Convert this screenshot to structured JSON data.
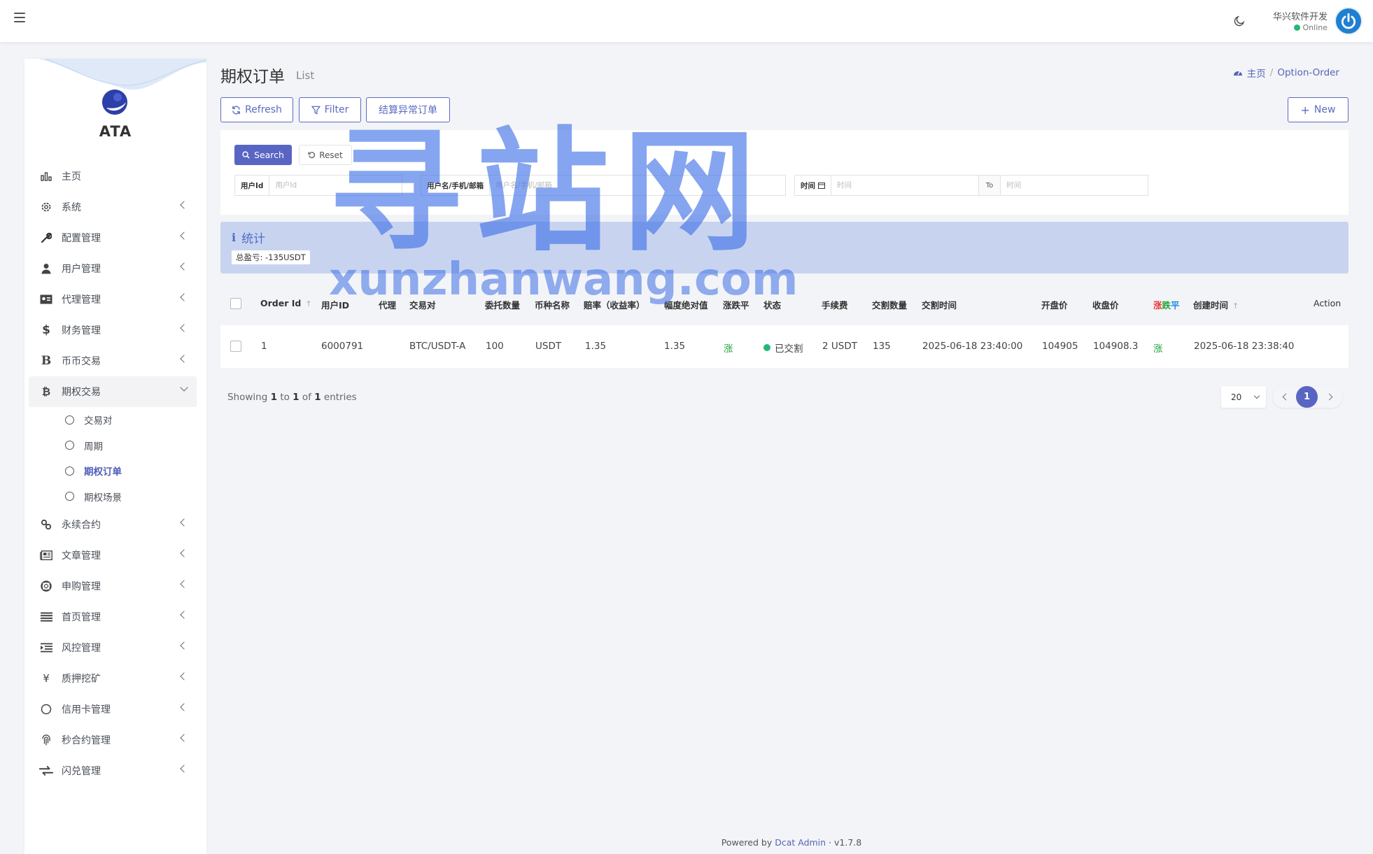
{
  "header": {
    "user_name": "华兴软件开发",
    "user_status": "Online"
  },
  "sidebar": {
    "logo_text": "ATA",
    "items": [
      {
        "label": "主页",
        "icon": "bar-chart-icon",
        "has_children": false
      },
      {
        "label": "系统",
        "icon": "gear-icon",
        "has_children": true
      },
      {
        "label": "配置管理",
        "icon": "wrench-icon",
        "has_children": true
      },
      {
        "label": "用户管理",
        "icon": "user-icon",
        "has_children": true
      },
      {
        "label": "代理管理",
        "icon": "id-card-icon",
        "has_children": true
      },
      {
        "label": "财务管理",
        "icon": "dollar-icon",
        "has_children": true
      },
      {
        "label": "币币交易",
        "icon": "bitcoin-b-icon",
        "has_children": true
      },
      {
        "label": "期权交易",
        "icon": "bitcoin-icon",
        "has_children": true,
        "open": true
      },
      {
        "label": "永续合约",
        "icon": "link-icon",
        "has_children": true
      },
      {
        "label": "文章管理",
        "icon": "newspaper-icon",
        "has_children": true
      },
      {
        "label": "申购管理",
        "icon": "lifebuoy-icon",
        "has_children": true
      },
      {
        "label": "首页管理",
        "icon": "list-icon",
        "has_children": true
      },
      {
        "label": "风控管理",
        "icon": "indent-icon",
        "has_children": true
      },
      {
        "label": "质押挖矿",
        "icon": "yen-icon",
        "has_children": true
      },
      {
        "label": "信用卡管理",
        "icon": "circle-icon",
        "has_children": true
      },
      {
        "label": "秒合约管理",
        "icon": "fingerprint-icon",
        "has_children": true
      },
      {
        "label": "闪兑管理",
        "icon": "exchange-icon",
        "has_children": true
      }
    ],
    "subitems": [
      {
        "label": "交易对",
        "active": false
      },
      {
        "label": "周期",
        "active": false
      },
      {
        "label": "期权订单",
        "active": true
      },
      {
        "label": "期权场景",
        "active": false
      }
    ]
  },
  "page": {
    "title": "期权订单",
    "subtitle": "List",
    "breadcrumb_home": "主页",
    "breadcrumb_current": "Option-Order"
  },
  "toolbar": {
    "refresh_label": "Refresh",
    "filter_label": "Filter",
    "settle_label": "结算异常订单",
    "new_label": "New"
  },
  "filter": {
    "search_label": "Search",
    "reset_label": "Reset",
    "user_id_label": "用户Id",
    "user_id_placeholder": "用户Id",
    "user_name_label": "用户名/手机/邮箱",
    "user_name_placeholder": "用户名/手机/邮箱",
    "time_label": "时间",
    "time_start_placeholder": "时间",
    "time_to_label": "To",
    "time_end_placeholder": "时间"
  },
  "stats": {
    "title": "统计",
    "total_profit": "总盈亏: -135USDT"
  },
  "table": {
    "columns": [
      "Order Id",
      "用户ID",
      "代理",
      "交易对",
      "委托数量",
      "币种名称",
      "赔率（收益率）",
      "幅度绝对值",
      "涨跌平",
      "状态",
      "手续费",
      "交割数量",
      "交割时间",
      "开盘价",
      "收盘价",
      "涨跌平",
      "创建时间",
      "Action"
    ],
    "rows": [
      {
        "order_id": "1",
        "user_id": "6000791",
        "agent": "",
        "pair": "BTC/USDT-A",
        "amount": "100",
        "currency": "USDT",
        "odds": "1.35",
        "range": "1.35",
        "direction": "涨",
        "status": "已交割",
        "fee": "2 USDT",
        "delivery_qty": "135",
        "delivery_time": "2025-06-18 23:40:00",
        "open_price": "104905",
        "close_price": "104908.3",
        "result": "涨",
        "created_at": "2025-06-18 23:38:40"
      }
    ]
  },
  "pagination": {
    "showing_prefix": "Showing",
    "from": "1",
    "to_word": "to",
    "to": "1",
    "of_word": "of",
    "total": "1",
    "entries_word": "entries",
    "per_page": "20",
    "current_page": "1"
  },
  "footer": {
    "powered_by": "Powered by",
    "brand": "Dcat Admin",
    "version": "v1.7.8"
  },
  "watermark": {
    "cn": "寻站网",
    "en": "xunzhanwang.com"
  },
  "colors": {
    "primary": "#5865c3",
    "up": "#21a33b",
    "down": "#e53935",
    "status_green": "#21b978",
    "stats_bg": "#c8d4ef"
  }
}
